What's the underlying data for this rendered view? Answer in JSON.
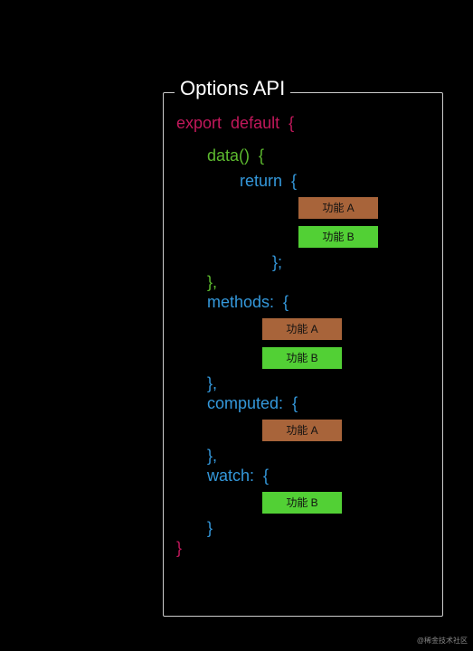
{
  "title": "Options API",
  "code": {
    "export": "export",
    "default": "default",
    "data": "data",
    "return": "return",
    "methods": "methods:",
    "computed": "computed:",
    "watch": "watch:"
  },
  "tags": {
    "a": "功能 A",
    "b": "功能 B"
  },
  "sections": {
    "data": [
      "a",
      "b"
    ],
    "methods": [
      "a",
      "b"
    ],
    "computed": [
      "a"
    ],
    "watch": [
      "b"
    ]
  },
  "watermark": "@稀金技术社区"
}
